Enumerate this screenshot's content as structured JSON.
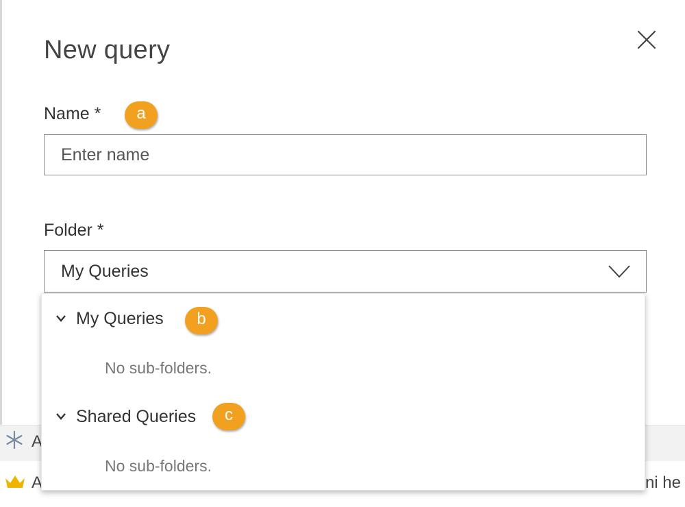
{
  "dialog": {
    "title": "New query",
    "close_icon": "close-icon",
    "name_label": "Name *",
    "name_placeholder": "Enter name",
    "name_value": "",
    "folder_label": "Folder *",
    "folder_value": "My Queries"
  },
  "dropdown": {
    "items": [
      {
        "label": "My Queries",
        "empty_text": "No sub-folders."
      },
      {
        "label": "Shared Queries",
        "empty_text": "No sub-folders."
      }
    ]
  },
  "callouts": {
    "a": "a",
    "b": "b",
    "c": "c"
  },
  "background": {
    "row1_text": "A",
    "row2_text": "A",
    "row2_right_text": "ini he"
  },
  "colors": {
    "badge": "#f2a020",
    "border": "#8a8a8a",
    "text": "#333333"
  }
}
